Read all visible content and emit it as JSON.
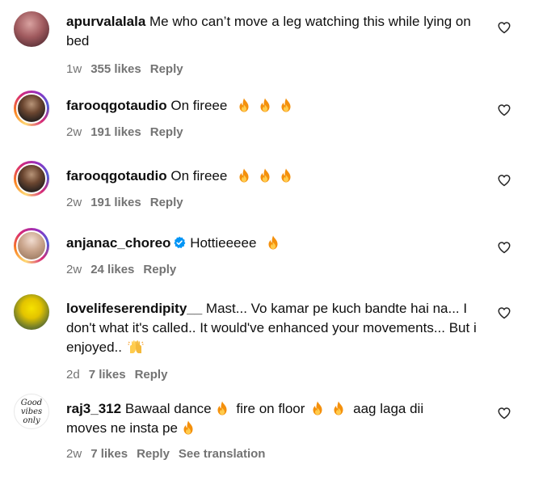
{
  "comments": [
    {
      "username": "apurvalalala",
      "text": "Me who can’t move a leg watching this while lying on bed",
      "time": "1w",
      "likes": "355 likes",
      "reply": "Reply"
    },
    {
      "username": "farooqgotaudio",
      "text": "On fireee",
      "time": "2w",
      "likes": "191 likes",
      "reply": "Reply"
    },
    {
      "username": "farooqgotaudio",
      "text": "On fireee",
      "time": "2w",
      "likes": "191 likes",
      "reply": "Reply"
    },
    {
      "username": "anjanac_choreo",
      "text": "Hottieeeee",
      "time": "2w",
      "likes": "24 likes",
      "reply": "Reply"
    },
    {
      "username": "lovelifeserendipity__",
      "text": "Mast... Vo kamar pe kuch bandte hai na... I don't what it's called.. It would've enhanced your movements... But i enjoyed..",
      "time": "2d",
      "likes": "7 likes",
      "reply": "Reply"
    },
    {
      "username": "raj3_312",
      "text_parts": [
        "Bawaal dance",
        "fire on floor",
        "aag laga dii",
        "moves ne insta pe"
      ],
      "time": "2w",
      "likes": "7 likes",
      "reply": "Reply",
      "see_translation": "See translation"
    }
  ],
  "avatar_text": {
    "raj3_312": "Good vibes only"
  },
  "icons": {
    "like": "heart-outline-icon",
    "emoji_fire": "fire-emoji",
    "emoji_hands": "raising-hands-emoji",
    "verified": "verified-badge-icon"
  },
  "colors": {
    "meta_text": "#737373",
    "verified_blue": "#0095f6"
  }
}
